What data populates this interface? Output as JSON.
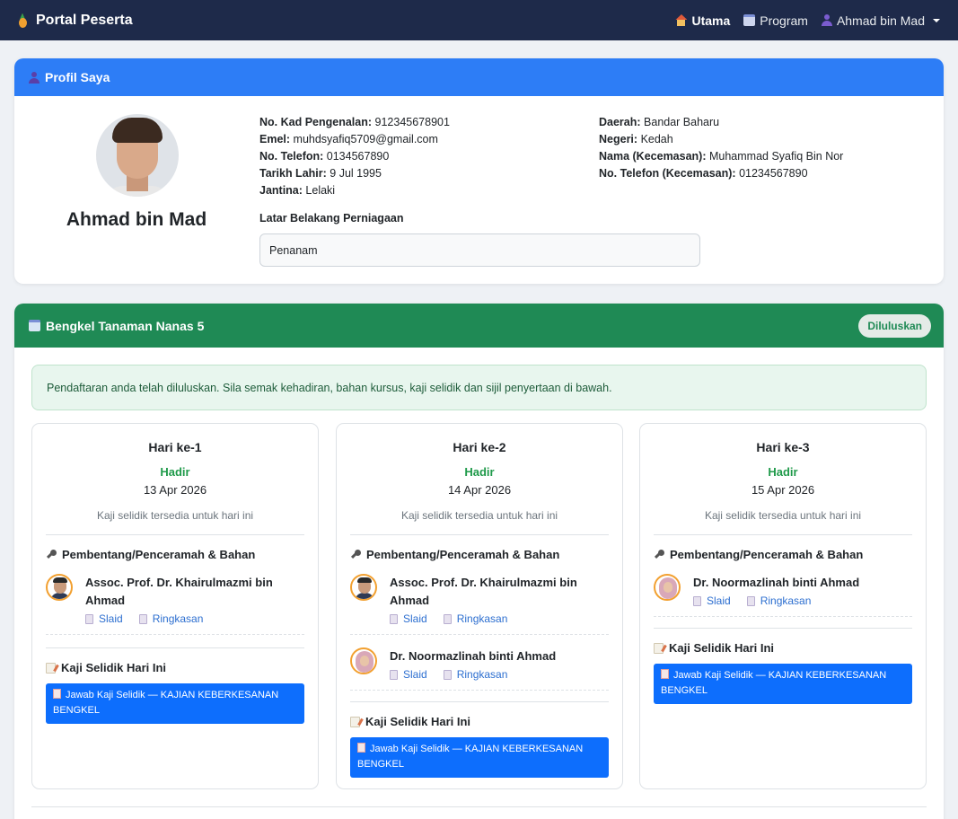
{
  "navbar": {
    "brand": "Portal Peserta",
    "items": [
      {
        "label": "Utama",
        "icon": "house-icon",
        "active": true
      },
      {
        "label": "Program",
        "icon": "calendar-icon",
        "active": false
      },
      {
        "label": "Ahmad bin Mad",
        "icon": "user-icon",
        "active": false
      }
    ]
  },
  "profile": {
    "header": "Profil Saya",
    "name": "Ahmad bin Mad",
    "left_fields": [
      {
        "label": "No. Kad Pengenalan:",
        "value": "912345678901"
      },
      {
        "label": "Emel:",
        "value": "muhdsyafiq5709@gmail.com"
      },
      {
        "label": "No. Telefon:",
        "value": "0134567890"
      },
      {
        "label": "Tarikh Lahir:",
        "value": "9 Jul 1995"
      },
      {
        "label": "Jantina:",
        "value": "Lelaki"
      }
    ],
    "right_fields": [
      {
        "label": "Daerah:",
        "value": "Bandar Baharu"
      },
      {
        "label": "Negeri:",
        "value": "Kedah"
      },
      {
        "label": "Nama (Kecemasan):",
        "value": "Muhammad Syafiq Bin Nor"
      },
      {
        "label": "No. Telefon (Kecemasan):",
        "value": "01234567890"
      }
    ],
    "business_label": "Latar Belakang Perniagaan",
    "business_value": "Penanam"
  },
  "workshop": {
    "title": "Bengkel Tanaman Nanas 5",
    "status_badge": "Diluluskan",
    "alert": "Pendaftaran anda telah diluluskan. Sila semak kehadiran, bahan kursus, kaji selidik dan sijil penyertaan di bawah.",
    "section_speakers": "Pembentang/Penceramah & Bahan",
    "section_survey": "Kaji Selidik Hari Ini",
    "link_slides": "Slaid",
    "link_summary": "Ringkasan",
    "survey_button": "Jawab Kaji Selidik — KAJIAN KEBERKESANAN BENGKEL",
    "days": [
      {
        "title": "Hari ke-1",
        "status": "Hadir",
        "date": "13 Apr 2026",
        "note": "Kaji selidik tersedia untuk hari ini",
        "speakers": [
          "Assoc. Prof. Dr. Khairulmazmi bin Ahmad"
        ]
      },
      {
        "title": "Hari ke-2",
        "status": "Hadir",
        "date": "14 Apr 2026",
        "note": "Kaji selidik tersedia untuk hari ini",
        "speakers": [
          "Assoc. Prof. Dr. Khairulmazmi bin Ahmad",
          "Dr. Noormazlinah binti Ahmad"
        ]
      },
      {
        "title": "Hari ke-3",
        "status": "Hadir",
        "date": "15 Apr 2026",
        "note": "Kaji selidik tersedia untuk hari ini",
        "speakers": [
          "Dr. Noormazlinah binti Ahmad"
        ]
      }
    ]
  },
  "colors": {
    "navbar": "#1e2a4a",
    "profile_header": "#2d7df6",
    "workshop_header": "#1f8a55",
    "status_present": "#1f9a4a",
    "primary_button": "#0d6efd"
  }
}
